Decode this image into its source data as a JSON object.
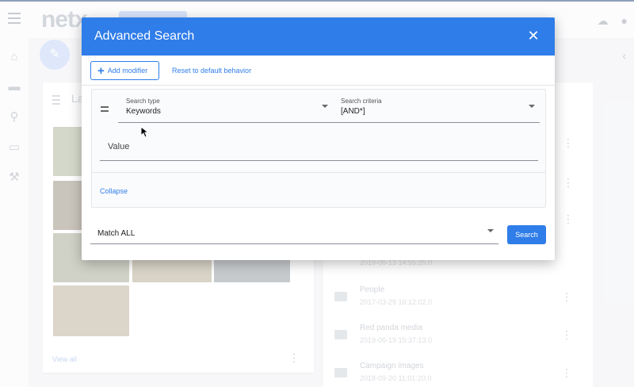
{
  "app": {
    "logo_text": "netx",
    "left_card": {
      "title": "La",
      "view_all": "View all"
    },
    "folders": [
      {
        "name": "",
        "date": "2019-06-13 14:55:25.0"
      },
      {
        "name": "People",
        "date": "2017-03-29 16:12:02.0"
      },
      {
        "name": "Red panda media",
        "date": "2019-06-19 15:37:13.0"
      },
      {
        "name": "Campaign images",
        "date": "2018-09-20 11:01:20.0"
      }
    ]
  },
  "dialog": {
    "title": "Advanced Search",
    "close_icon": "close-icon",
    "toolbar": {
      "add_modifier_label": "Add modifier",
      "reset_label": "Reset to default behavior"
    },
    "modifier": {
      "search_type": {
        "label": "Search type",
        "value": "Keywords"
      },
      "search_criteria": {
        "label": "Search criteria",
        "value": "[AND*]"
      },
      "value_placeholder": "Value",
      "collapse_label": "Collapse"
    },
    "match": {
      "value": "Match ALL"
    },
    "search_button": "Search"
  },
  "colors": {
    "accent": "#2f7de9",
    "header": "#2f7de9"
  }
}
